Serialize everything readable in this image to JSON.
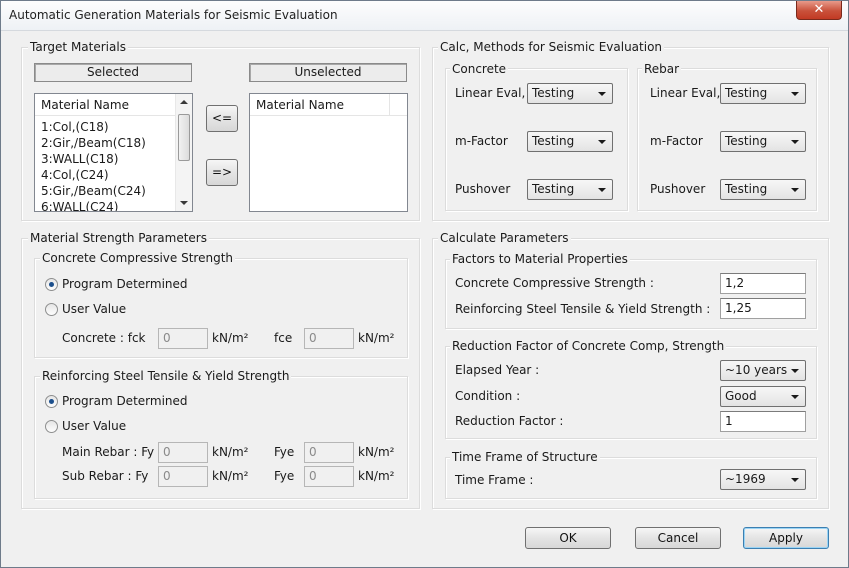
{
  "window": {
    "title": "Automatic Generation Materials for Seismic Evaluation",
    "close_glyph": "✕"
  },
  "target_materials": {
    "legend": "Target Materials",
    "selected_header": "Selected",
    "unselected_header": "Unselected",
    "selected_list": {
      "column": "Material Name",
      "items": [
        "1:Col,(C18)",
        "2:Gir,/Beam(C18)",
        "3:WALL(C18)",
        "4:Col,(C24)",
        "5:Gir,/Beam(C24)",
        "6:WALL(C24)"
      ]
    },
    "unselected_list": {
      "column": "Material Name",
      "items": []
    },
    "move_left_label": "<=",
    "move_right_label": "=>"
  },
  "calc_methods": {
    "legend": "Calc, Methods for Seismic Evaluation",
    "concrete": {
      "legend": "Concrete",
      "rows": [
        {
          "label": "Linear Eval,",
          "value": "Testing"
        },
        {
          "label": "m-Factor",
          "value": "Testing"
        },
        {
          "label": "Pushover",
          "value": "Testing"
        }
      ]
    },
    "rebar": {
      "legend": "Rebar",
      "rows": [
        {
          "label": "Linear Eval,",
          "value": "Testing"
        },
        {
          "label": "m-Factor",
          "value": "Testing"
        },
        {
          "label": "Pushover",
          "value": "Testing"
        }
      ]
    }
  },
  "strength_params": {
    "legend": "Material Strength Parameters",
    "concrete": {
      "legend": "Concrete Compressive Strength",
      "option_program": "Program Determined",
      "option_user": "User Value",
      "selected": "program",
      "fck_label": "Concrete : fck",
      "fck_value": "0",
      "fck_unit": "kN/m²",
      "fce_label": "fce",
      "fce_value": "0",
      "fce_unit": "kN/m²"
    },
    "steel": {
      "legend": "Reinforcing Steel Tensile & Yield Strength",
      "option_program": "Program Determined",
      "option_user": "User Value",
      "selected": "program",
      "main_label": "Main Rebar : Fy",
      "main_fy": "0",
      "main_fy_unit": "kN/m²",
      "main_fye_label": "Fye",
      "main_fye": "0",
      "main_fye_unit": "kN/m²",
      "sub_label": "Sub Rebar : Fy",
      "sub_fy": "0",
      "sub_fy_unit": "kN/m²",
      "sub_fye_label": "Fye",
      "sub_fye": "0",
      "sub_fye_unit": "kN/m²"
    }
  },
  "calc_params": {
    "legend": "Calculate Parameters",
    "factors": {
      "legend": "Factors to Material Properties",
      "concrete_label": "Concrete Compressive Strength :",
      "concrete_value": "1,2",
      "steel_label": "Reinforcing Steel Tensile & Yield Strength :",
      "steel_value": "1,25"
    },
    "reduction": {
      "legend": "Reduction Factor of Concrete Comp, Strength",
      "elapsed_label": "Elapsed Year :",
      "elapsed_value": "~10 years",
      "condition_label": "Condition :",
      "condition_value": "Good",
      "factor_label": "Reduction Factor :",
      "factor_value": "1"
    },
    "time_frame": {
      "legend": "Time Frame of Structure",
      "label": "Time Frame :",
      "value": "~1969"
    }
  },
  "buttons": {
    "ok": "OK",
    "cancel": "Cancel",
    "apply": "Apply"
  }
}
